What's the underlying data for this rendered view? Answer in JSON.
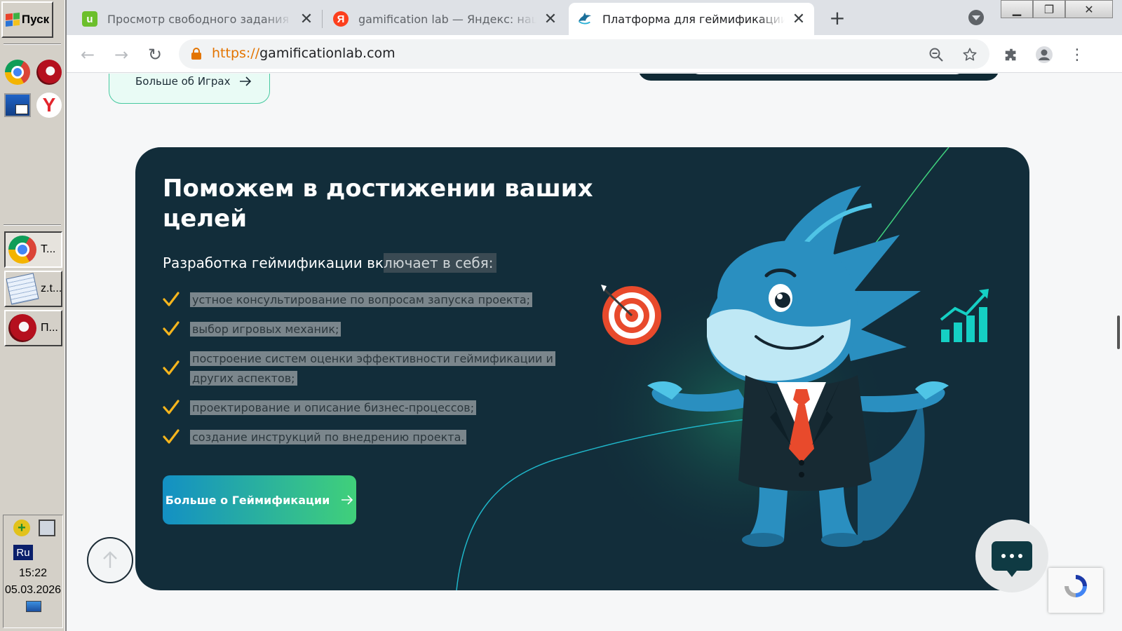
{
  "taskbar": {
    "start_label": "Пуск",
    "tasks": [
      {
        "label": "Т...",
        "icon": "chrome-icon"
      },
      {
        "label": "z.t...",
        "icon": "notepad-icon"
      },
      {
        "label": "П...",
        "icon": "opera-icon"
      }
    ],
    "language": "Ru",
    "time": "15:22",
    "date": "05.03.2026"
  },
  "browser": {
    "tabs": [
      {
        "title": "Просмотр свободного задания - В",
        "favicon": "u",
        "favicon_color": "#6cbf2c"
      },
      {
        "title": "gamification lab — Яндекс: нашёлс",
        "favicon": "Я",
        "favicon_color": "#fc3f1d"
      },
      {
        "title": "Платформа для геймификации и в",
        "favicon": "shark",
        "active": true
      }
    ],
    "new_tab_label": "+",
    "url_scheme": "https://",
    "url_host": "gamificationlab.com"
  },
  "page": {
    "top_card_link": "Больше об Играх",
    "card": {
      "title": "Поможем в достижении ваших целей",
      "lead_plain": "Разработка геймификации вк",
      "lead_highlight": "лючает в себя:",
      "items": [
        "устное консультирование по вопросам запуска проекта;",
        "выбор игровых механик;",
        "построение систем оценки эффективности геймификации и других аспектов;",
        "проектирование и описание бизнес-процессов;",
        "создание инструкций по внедрению проекта."
      ],
      "cta_label": "Больше о Геймификации"
    },
    "colors": {
      "card_bg": "#122d3a",
      "check": "#f5b51d",
      "cta_start": "#1390c4",
      "cta_end": "#40d07a",
      "accent_green": "#3fd27e"
    }
  }
}
